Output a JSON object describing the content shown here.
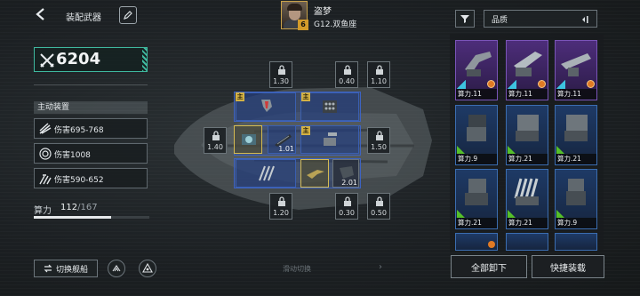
{
  "header": {
    "back_icon": "back-arrow-icon",
    "title": "装配武器",
    "edit_icon": "pencil-icon"
  },
  "pilot": {
    "name": "盗梦",
    "level": "6",
    "ship": "G12.双鱼座"
  },
  "left": {
    "power_icon": "crossed-swords-icon",
    "power_value": "6204",
    "section_label": "主动装置",
    "active_items": [
      {
        "icon": "missile-icon",
        "label": "伤害695-768"
      },
      {
        "icon": "target-icon",
        "label": "伤害1008"
      },
      {
        "icon": "drone-swarm-icon",
        "label": "伤害590-652"
      }
    ],
    "compute_label": "算力",
    "compute_used": "112",
    "compute_max": "/167",
    "compute_fraction": 0.67,
    "switch_label": "切换舰船",
    "swipe_hint": "滑动切换"
  },
  "slots": {
    "locked": [
      "1.30",
      "0.40",
      "1.10",
      "1.40",
      "1.50",
      "1.20",
      "0.30",
      "0.50"
    ],
    "weapons": [
      "1.01",
      "2.01"
    ],
    "main_badge": "主"
  },
  "right": {
    "sort_label": "品质",
    "cards": [
      {
        "rarity": "purple",
        "label": "算力.11"
      },
      {
        "rarity": "purple",
        "label": "算力.11"
      },
      {
        "rarity": "purple",
        "label": "算力.11"
      },
      {
        "rarity": "blue",
        "label": "算力.9"
      },
      {
        "rarity": "blue",
        "label": "算力.21"
      },
      {
        "rarity": "blue",
        "label": "算力.21"
      },
      {
        "rarity": "blue",
        "label": "算力.21"
      },
      {
        "rarity": "blue",
        "label": "算力.21"
      },
      {
        "rarity": "blue",
        "label": "算力.9"
      }
    ],
    "unequip_all": "全部卸下",
    "quick_equip": "快捷装载"
  },
  "colors": {
    "accent": "#3fb99f",
    "slot_blue": "#3d63c2",
    "slot_gold": "#d5bb52",
    "rare_purple": "#7a54b8",
    "rare_blue": "#3b6db0"
  }
}
